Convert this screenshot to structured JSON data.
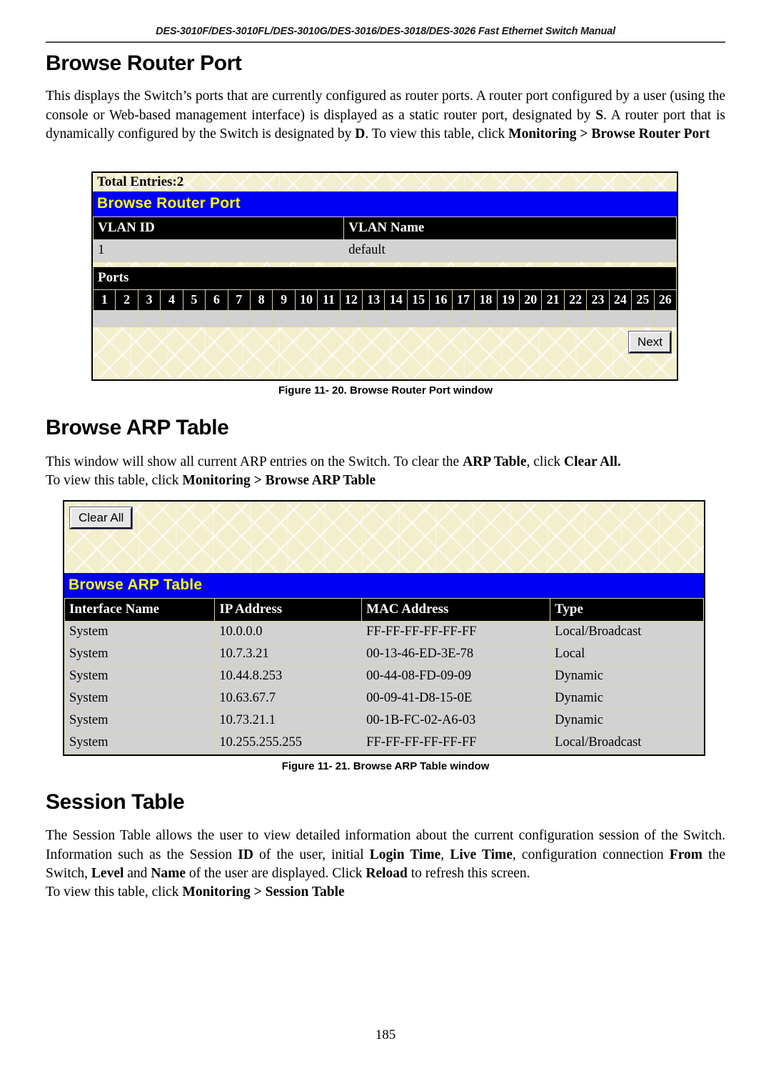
{
  "document": {
    "running_header": "DES-3010F/DES-3010FL/DES-3010G/DES-3016/DES-3018/DES-3026 Fast Ethernet Switch Manual",
    "page_number": "185"
  },
  "sections": {
    "browse_router_port": {
      "heading": "Browse Router Port",
      "paragraph_part1": "This displays the Switch’s ports that are currently configured as router ports. A router port configured by a user (using the console or Web-based management interface) is displayed as a static router port, designated by ",
      "bold_s": "S",
      "paragraph_part2": ". A router port that is dynamically configured by the Switch is designated by ",
      "bold_d": "D",
      "paragraph_part3": ". To view this table, click ",
      "nav_path": "Monitoring > Browse Router Port",
      "caption": "Figure 11- 20. Browse Router Port window"
    },
    "browse_arp_table": {
      "heading": "Browse ARP Table",
      "paragraph_part1": "This window will show all current ARP entries on the Switch. To clear the ",
      "bold_arp_table": "ARP Table",
      "paragraph_part2": ", click ",
      "bold_clear_all": "Clear All.",
      "paragraph_part3": "To view this table, click ",
      "nav_path": "Monitoring > Browse ARP Table",
      "caption": "Figure 11- 21. Browse ARP Table window"
    },
    "session_table": {
      "heading": "Session Table",
      "p1": "The Session Table allows the user to view detailed information about the current configuration session of the Switch. Information such as the Session ",
      "b_id": "ID",
      "p2": " of the user, initial ",
      "b_login_time": "Login Time",
      "p3": ", ",
      "b_live_time": "Live Time",
      "p4": ", configuration connection ",
      "b_from": "From",
      "p5": " the Switch, ",
      "b_level": "Level",
      "p6": " and ",
      "b_name": "Name",
      "p7": " of the user are displayed. Click ",
      "b_reload": "Reload",
      "p8": " to refresh this screen.",
      "p9": "To view this table, click ",
      "nav_path": "Monitoring > Session Table"
    }
  },
  "router_port_window": {
    "total_entries_label": "Total Entries:2",
    "title_bar": "Browse Router Port",
    "vlan_headers": [
      "VLAN ID",
      "VLAN Name"
    ],
    "vlan_rows": [
      [
        "1",
        "default"
      ]
    ],
    "ports_label": "Ports",
    "port_numbers": [
      "1",
      "2",
      "3",
      "4",
      "5",
      "6",
      "7",
      "8",
      "9",
      "10",
      "11",
      "12",
      "13",
      "14",
      "15",
      "16",
      "17",
      "18",
      "19",
      "20",
      "21",
      "22",
      "23",
      "24",
      "25",
      "26"
    ],
    "port_values": [
      "",
      "",
      "",
      "",
      "",
      "",
      "",
      "",
      "",
      "",
      "",
      "",
      "",
      "",
      "",
      "",
      "",
      "",
      "",
      "",
      "",
      "",
      "",
      "",
      "",
      ""
    ],
    "next_button": "Next"
  },
  "arp_window": {
    "clear_all_button": "Clear All",
    "title_bar": "Browse ARP Table",
    "headers": [
      "Interface Name",
      "IP Address",
      "MAC Address",
      "Type"
    ],
    "rows": [
      [
        "System",
        "10.0.0.0",
        "FF-FF-FF-FF-FF-FF",
        "Local/Broadcast"
      ],
      [
        "System",
        "10.7.3.21",
        "00-13-46-ED-3E-78",
        "Local"
      ],
      [
        "System",
        "10.44.8.253",
        "00-44-08-FD-09-09",
        "Dynamic"
      ],
      [
        "System",
        "10.63.67.7",
        "00-09-41-D8-15-0E",
        "Dynamic"
      ],
      [
        "System",
        "10.73.21.1",
        "00-1B-FC-02-A6-03",
        "Dynamic"
      ],
      [
        "System",
        "10.255.255.255",
        "FF-FF-FF-FF-FF-FF",
        "Local/Broadcast"
      ]
    ]
  },
  "colors": {
    "title_bar_bg": "#0000f5",
    "title_bar_text": "#ffff00",
    "header_bg": "#000000",
    "header_text": "#ffffff",
    "cell_bg": "#d2d2d2",
    "window_bg": "#f3eecb"
  }
}
